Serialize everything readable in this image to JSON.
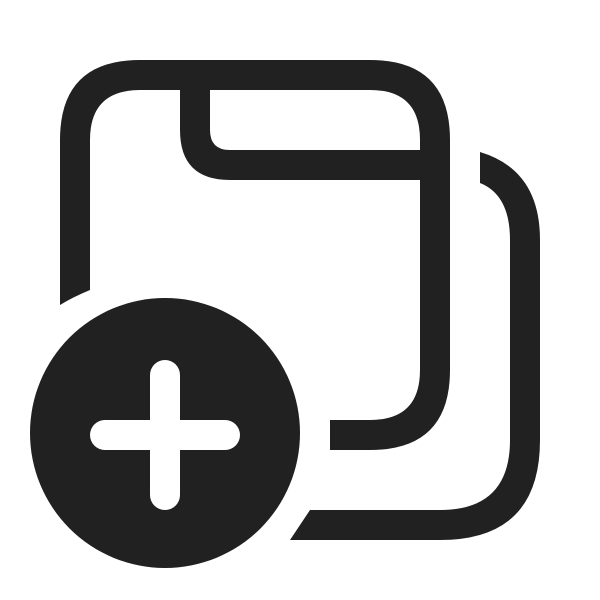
{
  "icon": {
    "name": "add-tab-stack-icon",
    "description_name": "add-window-icon",
    "badge_icon": "plus-circle-icon",
    "color": "#212121",
    "background": "#ffffff"
  }
}
